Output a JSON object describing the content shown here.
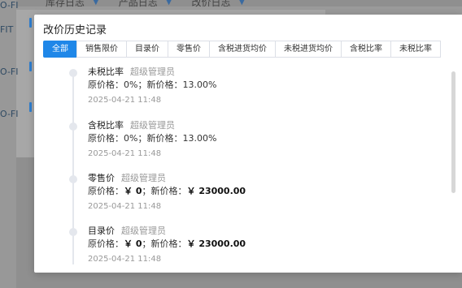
{
  "background": {
    "tabs": [
      {
        "label": "库存日志"
      },
      {
        "label": "产品日志"
      },
      {
        "label": "改价日志"
      }
    ],
    "left_codes": [
      "O-FI",
      "FIT",
      "O-FI",
      "O-FI"
    ]
  },
  "modal": {
    "title": "改价历史记录",
    "tabs": [
      {
        "label": "全部",
        "active": true
      },
      {
        "label": "销售限价"
      },
      {
        "label": "目录价"
      },
      {
        "label": "零售价"
      },
      {
        "label": "含税进货均价"
      },
      {
        "label": "未税进货均价"
      },
      {
        "label": "含税比率"
      },
      {
        "label": "未税比率"
      }
    ],
    "entries": [
      {
        "field": "未税比率",
        "user": "超级管理员",
        "old_label": "原价格：",
        "old": "0%",
        "sep": "；新价格：",
        "new": "13.00%",
        "time": "2025-04-21 11:48"
      },
      {
        "field": "含税比率",
        "user": "超级管理员",
        "old_label": "原价格：",
        "old": "0%",
        "sep": "；新价格：",
        "new": "13.00%",
        "time": "2025-04-21 11:48"
      },
      {
        "field": "零售价",
        "user": "超级管理员",
        "old_label": "原价格：",
        "old": "￥ 0",
        "sep": "；新价格：",
        "new": "￥ 23000.00",
        "time": "2025-04-21 11:48"
      },
      {
        "field": "目录价",
        "user": "超级管理员",
        "old_label": "原价格：",
        "old": "￥ 0",
        "sep": "；新价格：",
        "new": "￥ 23000.00",
        "time": "2025-04-21 11:48"
      }
    ]
  },
  "colors": {
    "accent": "#1f87e8",
    "overlay": "#8f8f8f"
  }
}
